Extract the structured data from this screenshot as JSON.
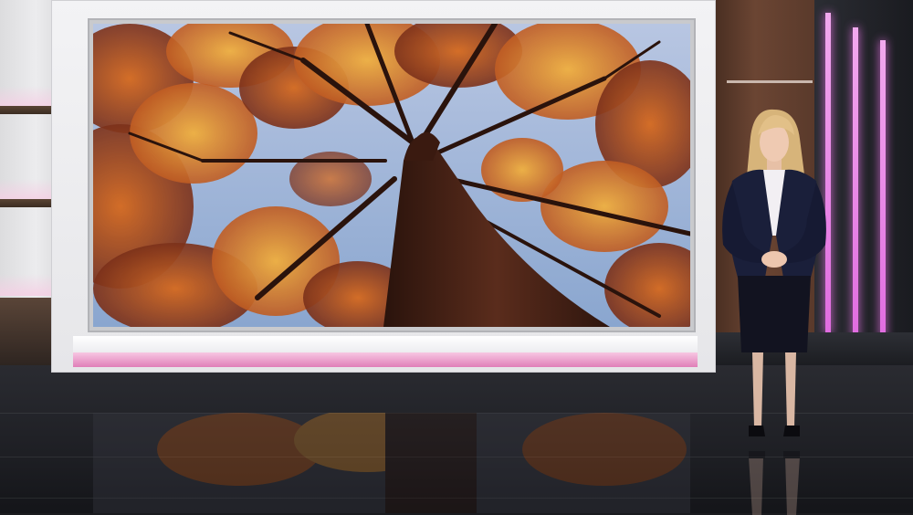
{
  "scene": {
    "description_type": "virtual-studio",
    "colors": {
      "accent_pink": "#e07fb8",
      "neon_pink": "#e06ce0",
      "wood": "#6b4533",
      "floor": "#1e1f24",
      "sky": "#9fb6d8",
      "foliage_orange": "#d4681c",
      "foliage_gold": "#e6a23a",
      "trunk": "#4a2318"
    }
  }
}
